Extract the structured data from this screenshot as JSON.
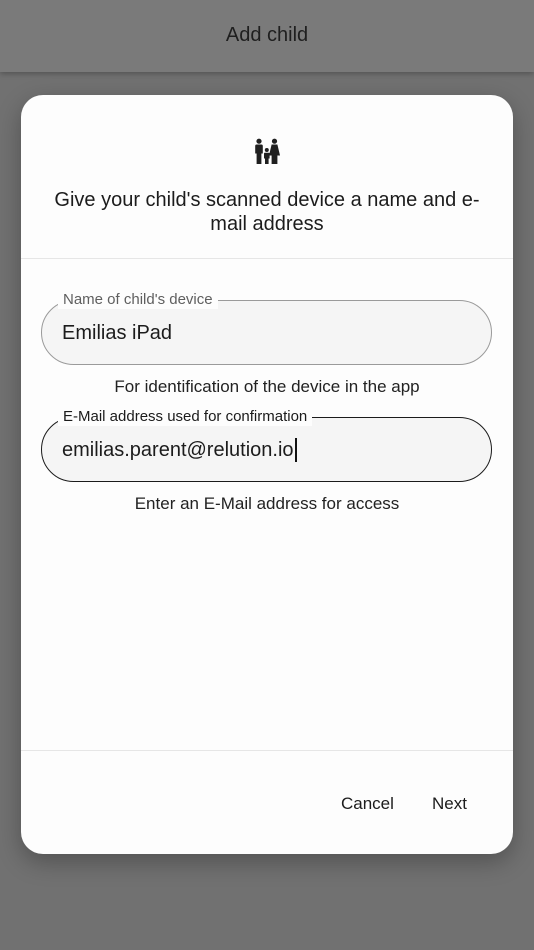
{
  "header": {
    "title": "Add child"
  },
  "dialog": {
    "icon": "family-icon",
    "heading": "Give your child's scanned device a name and e-mail address",
    "device_field": {
      "label": "Name of child's device",
      "value": "Emilias iPad",
      "helper": "For identification of the device in the app"
    },
    "email_field": {
      "label": "E-Mail address used for confirmation",
      "value": "emilias.parent@relution.io",
      "helper": "Enter an E-Mail address for access"
    },
    "actions": {
      "cancel": "Cancel",
      "next": "Next"
    }
  }
}
